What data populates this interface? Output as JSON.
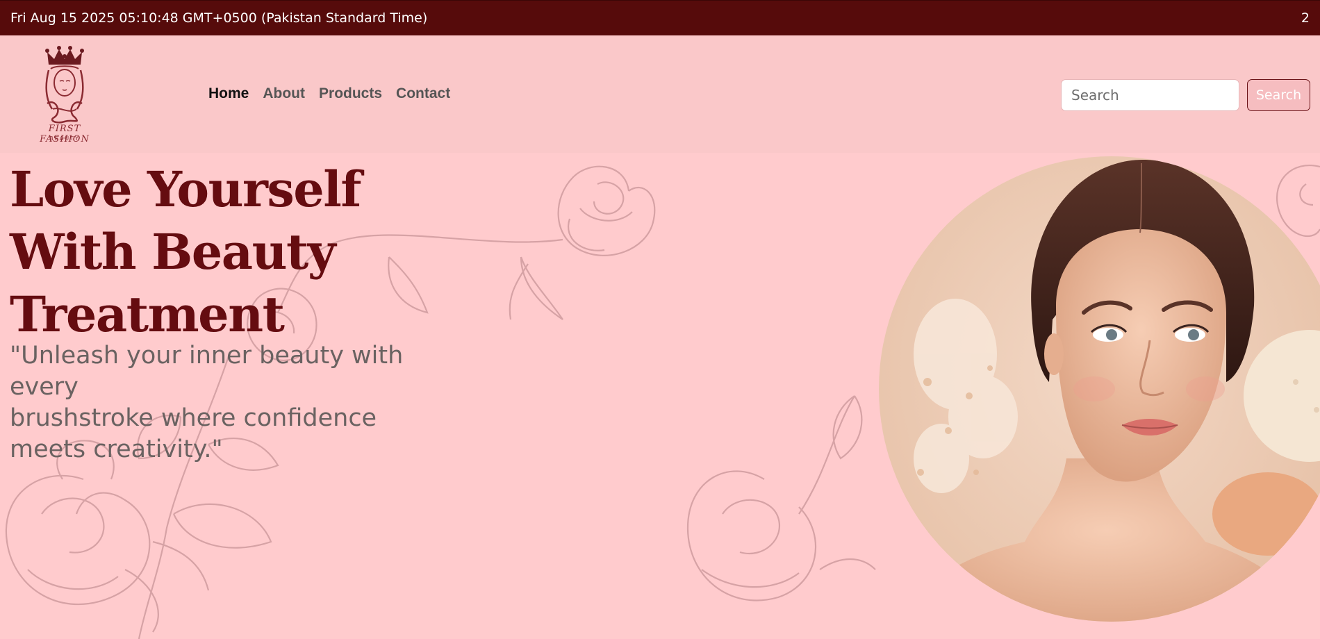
{
  "topbar": {
    "datetime": "Fri Aug 15 2025 05:10:48 GMT+0500 (Pakistan Standard Time)",
    "counter": "2"
  },
  "logo": {
    "brand": "FIRST FASHION",
    "sub": "BEAUTY",
    "icon": "crown-woman-logo-icon"
  },
  "nav": {
    "items": [
      {
        "label": "Home",
        "active": true
      },
      {
        "label": "About",
        "active": false
      },
      {
        "label": "Products",
        "active": false
      },
      {
        "label": "Contact",
        "active": false
      }
    ]
  },
  "search": {
    "placeholder": "Search",
    "value": "",
    "button_label": "Search"
  },
  "hero": {
    "headline": [
      "Love Yourself",
      "With Beauty",
      "Treatment"
    ],
    "tagline": [
      "\"Unleash your inner beauty with every",
      "brushstroke where confidence",
      "meets creativity.\""
    ]
  },
  "colors": {
    "topbar_bg": "#560b0b",
    "navbar_bg": "#fac8c9",
    "hero_bg": "#ffcbcd",
    "headline": "#650c10",
    "tagline": "#6a6261"
  }
}
